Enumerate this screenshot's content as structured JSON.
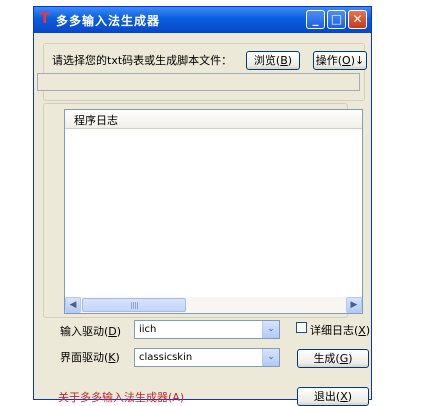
{
  "window": {
    "title": "多多输入法生成器",
    "app_icon_glyph": "T",
    "min_glyph": "_",
    "max_glyph": "□",
    "close_glyph": "✕"
  },
  "file_select": {
    "label": "请选择您的txt码表或生成脚本文件：",
    "path_value": "",
    "browse_label": "浏览(",
    "browse_key": "B",
    "action_label": "操作(",
    "action_key": "O",
    "action_suffix": ")↓"
  },
  "log": {
    "header": "程序日志",
    "scroll_left": "◀",
    "scroll_right": "▶"
  },
  "input_driver": {
    "label": "输入驱动(",
    "key": "D",
    "value": "iich",
    "dropdown_glyph": "⌄"
  },
  "ui_driver": {
    "label": "界面驱动(",
    "key": "K",
    "value": "classicskin",
    "dropdown_glyph": "⌄"
  },
  "detail_log": {
    "label": "详细日志(",
    "key": "X",
    "checked": false
  },
  "generate_button": {
    "label": "生成(",
    "key": "G"
  },
  "about_link": "关于多多输入法生成器(A)",
  "exit_button": {
    "label": "退出(",
    "key": "X"
  },
  "close_paren": ")",
  "colors": {
    "title_bar": "#0a5ee0",
    "window_bg": "#ece9d8",
    "link": "#c0272d"
  }
}
